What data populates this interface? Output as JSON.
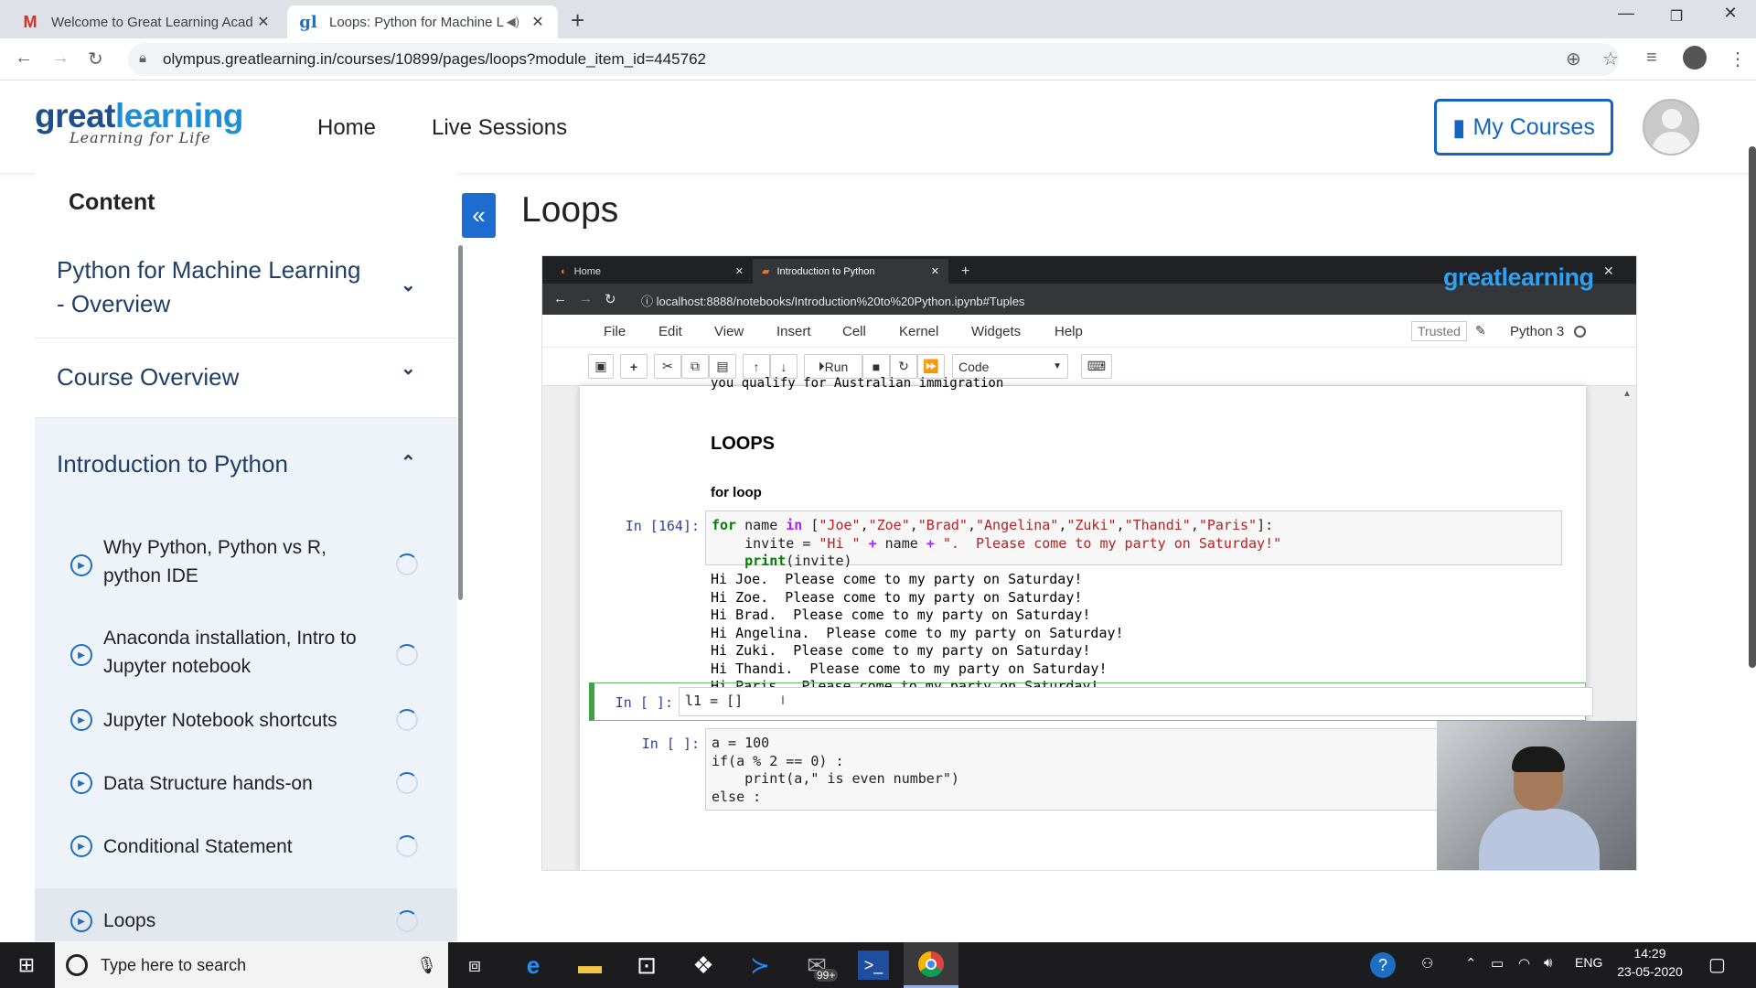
{
  "browser": {
    "tabs": [
      {
        "title": "Welcome to Great Learning Acad",
        "favicon": "gmail-icon"
      },
      {
        "title": "Loops: Python for Machine L",
        "favicon": "greatlearning-icon"
      }
    ],
    "new_tab": "+",
    "url": "olympus.greatlearning.in/courses/10899/pages/loops?module_item_id=445762"
  },
  "site": {
    "logo_great": "great",
    "logo_learning": "learning",
    "logo_tagline": "Learning for Life",
    "nav": [
      "Home",
      "Live Sessions"
    ],
    "my_courses": "My Courses"
  },
  "sidebar": {
    "heading": "Content",
    "modules": [
      {
        "label": "Python for Machine Learning - Overview",
        "expanded": false
      },
      {
        "label": "Course Overview",
        "expanded": false
      },
      {
        "label": "Introduction to Python",
        "expanded": true
      }
    ],
    "items": [
      {
        "label": "Why Python, Python vs R, python IDE"
      },
      {
        "label": "Anaconda installation, Intro to Jupyter notebook"
      },
      {
        "label": "Jupyter Notebook shortcuts"
      },
      {
        "label": "Data Structure hands-on"
      },
      {
        "label": "Conditional Statement"
      },
      {
        "label": "Loops"
      }
    ]
  },
  "page": {
    "title": "Loops"
  },
  "video": {
    "tabs": [
      "Home",
      "Introduction to Python"
    ],
    "url": "localhost:8888/notebooks/Introduction%20to%20Python.ipynb#Tuples",
    "logo": "greatlearning",
    "menu": [
      "File",
      "Edit",
      "View",
      "Insert",
      "Cell",
      "Kernel",
      "Widgets",
      "Help"
    ],
    "trusted": "Trusted",
    "kernel": "Python 3",
    "run_label": "Run",
    "cell_type": "Code",
    "cut_text": "you qualify for Australian immigration",
    "heading": "LOOPS",
    "subheading": "for loop",
    "cell1_prompt": "In [164]:",
    "cell1_code": [
      "for name in [\"Joe\",\"Zoe\",\"Brad\",\"Angelina\",\"Zuki\",\"Thandi\",\"Paris\"]:",
      "    invite = \"Hi \" + name + \".  Please come to my party on Saturday!\"",
      "    print(invite)"
    ],
    "output": [
      "Hi Joe.  Please come to my party on Saturday!",
      "Hi Zoe.  Please come to my party on Saturday!",
      "Hi Brad.  Please come to my party on Saturday!",
      "Hi Angelina.  Please come to my party on Saturday!",
      "Hi Zuki.  Please come to my party on Saturday!",
      "Hi Thandi.  Please come to my party on Saturday!",
      "Hi Paris.  Please come to my party on Saturday!"
    ],
    "cell2_prompt": "In [ ]:",
    "cell2_code": "l1 = []",
    "cell3_prompt": "In [ ]:",
    "cell3_code": [
      "a = 100",
      "if(a % 2 == 0) :",
      "    print(a,\" is even number\")",
      "else :"
    ]
  },
  "taskbar": {
    "search_placeholder": "Type here to search",
    "badge": "99+",
    "lang": "ENG",
    "time": "14:29",
    "date": "23-05-2020"
  }
}
